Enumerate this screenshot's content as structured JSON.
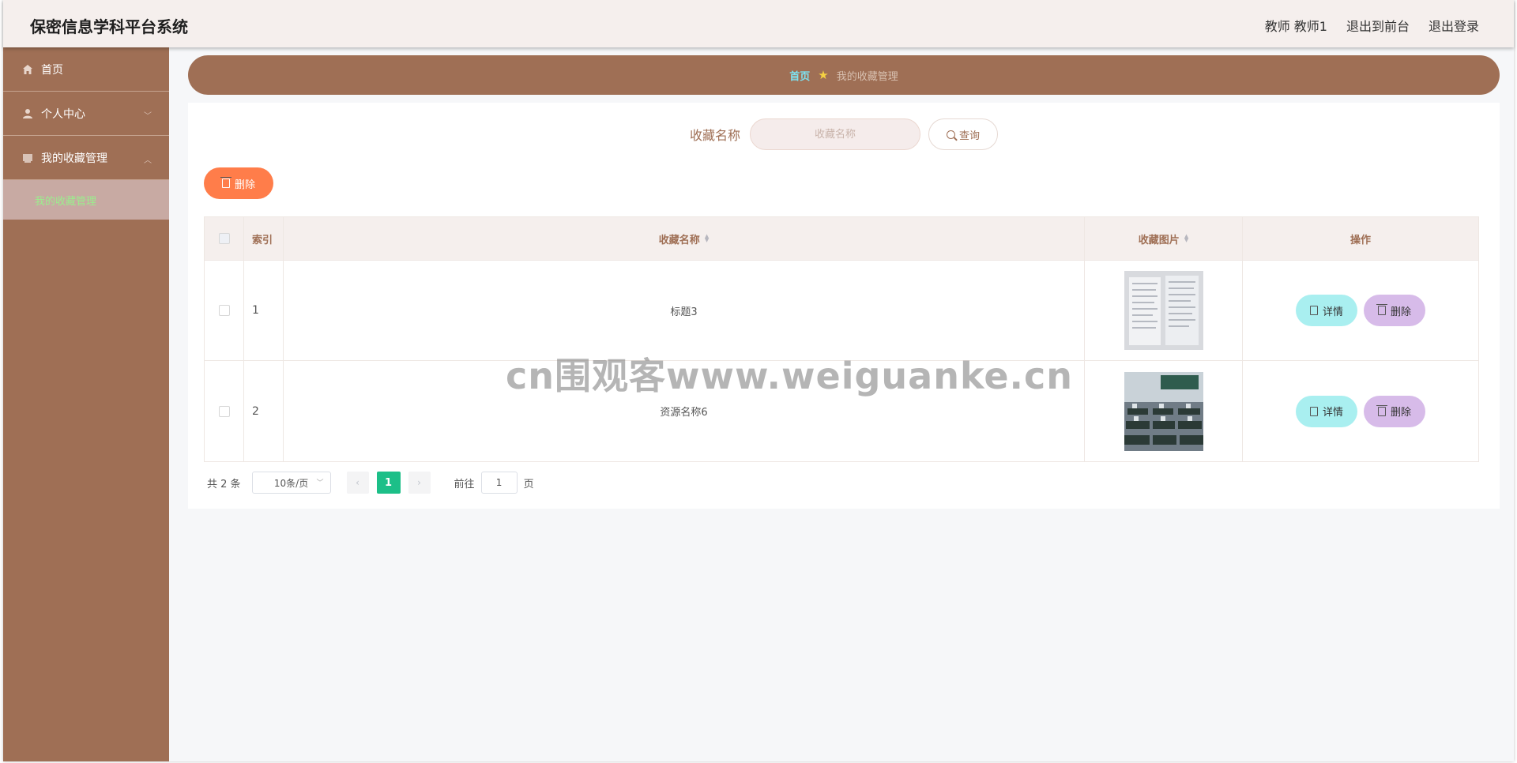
{
  "header": {
    "title": "保密信息学科平台系统",
    "user_label": "教师 教师1",
    "to_front_label": "退出到前台",
    "logout_label": "退出登录"
  },
  "sidebar": {
    "items": [
      {
        "label": "首页",
        "icon": "home-icon"
      },
      {
        "label": "个人中心",
        "icon": "user-icon"
      },
      {
        "label": "我的收藏管理",
        "icon": "folder-icon"
      }
    ],
    "submenu": {
      "label": "我的收藏管理"
    }
  },
  "breadcrumb": {
    "home": "首页",
    "separator_icon": "star-icon",
    "current": "我的收藏管理"
  },
  "search": {
    "label": "收藏名称",
    "placeholder": "收藏名称",
    "value": "",
    "button_label": "查询"
  },
  "toolbar": {
    "delete_label": "删除"
  },
  "table": {
    "columns": {
      "index": "索引",
      "name": "收藏名称",
      "image": "收藏图片",
      "ops": "操作"
    },
    "rows": [
      {
        "index": "1",
        "name": "标题3",
        "image": "document-photo",
        "detail": "详情",
        "delete": "删除"
      },
      {
        "index": "2",
        "name": "资源名称6",
        "image": "classroom-photo",
        "detail": "详情",
        "delete": "删除"
      }
    ]
  },
  "pagination": {
    "total": "共 2 条",
    "page_size": "10条/页",
    "current_page": "1",
    "goto_prefix": "前往",
    "goto_value": "1",
    "goto_suffix": "页"
  },
  "watermark": "cn围观客www.weiguanke.cn",
  "colors": {
    "brand": "#9f6f55",
    "header_bg": "#f5efed",
    "danger": "#ff7d4a",
    "detail": "#a9eff0",
    "delete": "#d7bbe9",
    "pager_active": "#1cbf88",
    "breadcrumb_home": "#7de3f2"
  }
}
